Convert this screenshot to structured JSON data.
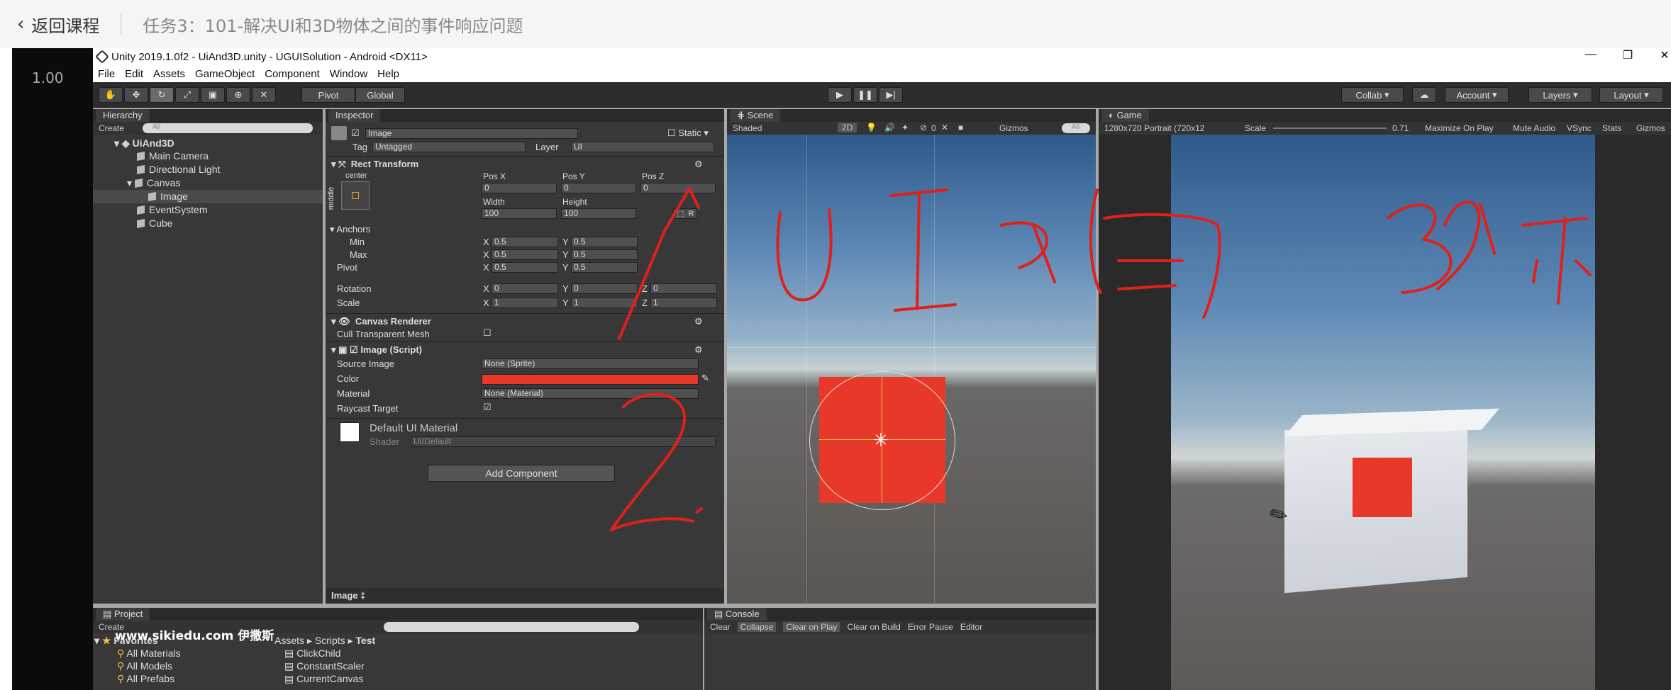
{
  "course_header": {
    "back_label": "返回课程",
    "task_title": "任务3：101-解决UI和3D物体之间的事件响应问题"
  },
  "player": {
    "speed": "1.00",
    "watermark": "www.sikiedu.com 伊撒斯"
  },
  "window": {
    "title": "Unity 2019.1.0f2 - UiAnd3D.unity - UGUISolution - Android <DX11>"
  },
  "menu": [
    "File",
    "Edit",
    "Assets",
    "GameObject",
    "Component",
    "Window",
    "Help"
  ],
  "toolbar": {
    "pivot": "Pivot",
    "global": "Global",
    "collab": "Collab",
    "account": "Account",
    "layers": "Layers",
    "layout": "Layout"
  },
  "hierarchy": {
    "tab": "Hierarchy",
    "create": "Create",
    "search": "All",
    "scene": "UiAnd3D",
    "items": [
      "Main Camera",
      "Directional Light",
      "Canvas",
      "Image",
      "EventSystem",
      "Cube"
    ]
  },
  "inspector": {
    "tab": "Inspector",
    "object_name": "Image",
    "static": "Static",
    "tag_label": "Tag",
    "tag_value": "Untagged",
    "layer_label": "Layer",
    "layer_value": "UI",
    "rect_transform": "Rect Transform",
    "center": "center",
    "middle": "middle",
    "posx_label": "Pos X",
    "posy_label": "Pos Y",
    "posz_label": "Pos Z",
    "posx": "0",
    "posy": "0",
    "posz": "0",
    "width_label": "Width",
    "height_label": "Height",
    "width": "100",
    "height": "100",
    "anchors": "Anchors",
    "min": "Min",
    "max": "Max",
    "pivot": "Pivot",
    "rotation": "Rotation",
    "scale": "Scale",
    "x_axis": "X",
    "y_axis": "Y",
    "z_axis": "Z",
    "min_x": "0.5",
    "min_y": "0.5",
    "max_x": "0.5",
    "max_y": "0.5",
    "pivot_x": "0.5",
    "pivot_y": "0.5",
    "rot_x": "0",
    "rot_y": "0",
    "rot_z": "0",
    "scale_x": "1",
    "scale_y": "1",
    "scale_z": "1",
    "canvas_renderer": "Canvas Renderer",
    "cull": "Cull Transparent Mesh",
    "image_script": "Image (Script)",
    "source_image": "Source Image",
    "source_value": "None (Sprite)",
    "color": "Color",
    "color_value": "#e8382a",
    "material": "Material",
    "material_value": "None (Material)",
    "raycast": "Raycast Target",
    "default_material": "Default UI Material",
    "shader": "Shader",
    "shader_value": "UI/Default",
    "add_component": "Add Component",
    "footer": "Image ‡"
  },
  "scene_view": {
    "tab": "Scene",
    "mode": "Shaded",
    "btn_2d": "2D",
    "gizmos": "Gizmos",
    "search": "All",
    "hidden_count": "0"
  },
  "game_view": {
    "tab": "Game",
    "resolution": "1280x720 Portrait (720x12",
    "scale_label": "Scale",
    "scale_value": "0.71",
    "maximize": "Maximize On Play",
    "mute": "Mute Audio",
    "vsync": "VSync",
    "stats": "Stats",
    "gizmos": "Gizmos"
  },
  "project": {
    "tab": "Project",
    "create": "Create",
    "favorites": "Favorites",
    "fav_items": [
      "All Materials",
      "All Models",
      "All Prefabs"
    ],
    "breadcrumb": [
      "Assets",
      "Scripts",
      "Test"
    ],
    "files": [
      "ClickChild",
      "ConstantScaler",
      "CurrentCanvas"
    ]
  },
  "console": {
    "tab": "Console",
    "buttons": [
      "Clear",
      "Collapse",
      "Clear on Play",
      "Clear on Build",
      "Error Pause",
      "Editor"
    ]
  },
  "colors": {
    "image_red": "#e8382a",
    "unity_dark": "#383838",
    "toolbar": "#2d2d2d",
    "ink": "#e0201a"
  }
}
